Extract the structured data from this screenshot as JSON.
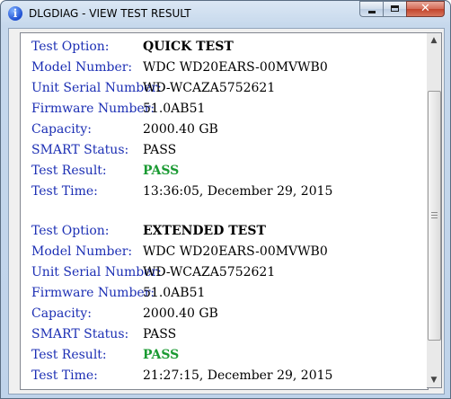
{
  "window": {
    "title": "DLGDIAG - VIEW TEST RESULT",
    "app_icon_glyph": "i",
    "close_glyph": "✕"
  },
  "labels": {
    "test_option": "Test Option:",
    "model_number": "Model Number:",
    "unit_serial_number": "Unit Serial Number:",
    "firmware_number": "Firmware Number:",
    "capacity": "Capacity:",
    "smart_status": "SMART Status:",
    "test_result": "Test Result:",
    "test_time": "Test Time:"
  },
  "results": [
    {
      "test_option": "QUICK TEST",
      "model_number": "WDC WD20EARS-00MVWB0",
      "unit_serial_number": "WD-WCAZA5752621",
      "firmware_number": "51.0AB51",
      "capacity": "2000.40 GB",
      "smart_status": "PASS",
      "test_result": "PASS",
      "test_time": "13:36:05, December 29, 2015"
    },
    {
      "test_option": "EXTENDED TEST",
      "model_number": "WDC WD20EARS-00MVWB0",
      "unit_serial_number": "WD-WCAZA5752621",
      "firmware_number": "51.0AB51",
      "capacity": "2000.40 GB",
      "smart_status": "PASS",
      "test_result": "PASS",
      "test_time": "21:27:15, December 29, 2015"
    }
  ],
  "colors": {
    "label_blue": "#1c2fb4",
    "pass_green": "#1a9a32"
  },
  "icons": {
    "app": "info-icon",
    "minimize": "minimize-icon",
    "maximize": "maximize-icon",
    "close": "close-icon",
    "scroll_up": "scroll-up-arrow-icon",
    "scroll_down": "scroll-down-arrow-icon"
  }
}
